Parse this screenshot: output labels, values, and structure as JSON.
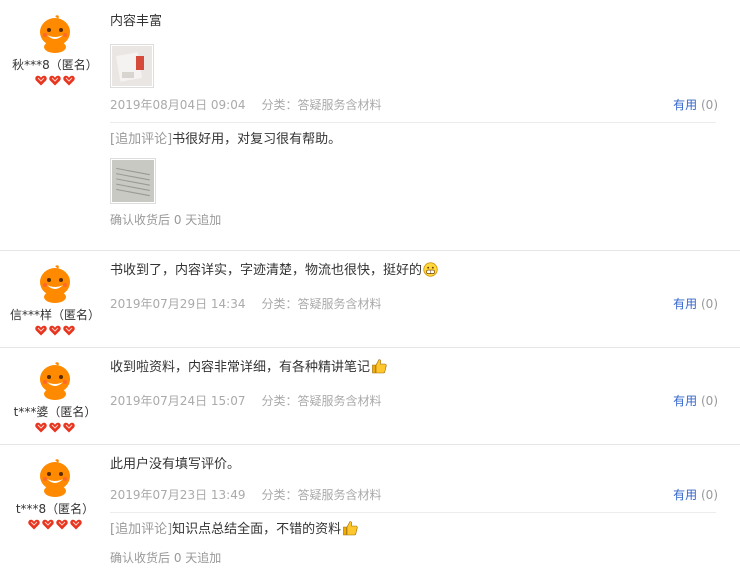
{
  "reviews": [
    {
      "user": {
        "name": "秋***8（匿名）",
        "rank_hearts": 3
      },
      "text": "内容丰富",
      "sticker": "",
      "images": [
        "photo-thumbnail"
      ],
      "date": "2019年08月04日 09:04",
      "category": "分类：答疑服务含材料",
      "useful_label": "有用",
      "useful_count": "(0)",
      "append": {
        "tag": "[追加评论]",
        "text": "书很好用，对复习很有帮助。",
        "sticker": "",
        "images": [
          "photo-thumbnail"
        ],
        "note": "确认收货后 0 天追加"
      }
    },
    {
      "user": {
        "name": "信***样（匿名）",
        "rank_hearts": 3
      },
      "text": "书收到了，内容详实，字迹清楚，物流也很快，挺好的",
      "sticker": "grin-emoji-icon",
      "images": [],
      "date": "2019年07月29日 14:34",
      "category": "分类：答疑服务含材料",
      "useful_label": "有用",
      "useful_count": "(0)"
    },
    {
      "user": {
        "name": "t***婆（匿名）",
        "rank_hearts": 3
      },
      "text": "收到啦资料，内容非常详细，有各种精讲笔记",
      "sticker": "thumbs-up-icon",
      "images": [],
      "date": "2019年07月24日 15:07",
      "category": "分类：答疑服务含材料",
      "useful_label": "有用",
      "useful_count": "(0)"
    },
    {
      "user": {
        "name": "t***8（匿名）",
        "rank_hearts": 4
      },
      "text": "此用户没有填写评价。",
      "sticker": "",
      "images": [],
      "date": "2019年07月23日 13:49",
      "category": "分类：答疑服务含材料",
      "useful_label": "有用",
      "useful_count": "(0)",
      "append": {
        "tag": "[追加评论]",
        "text": "知识点总结全面，不错的资料",
        "sticker": "thumbs-up-icon",
        "images": [],
        "note": "确认收货后 0 天追加"
      }
    }
  ],
  "colors": {
    "link": "#3366cc",
    "meta": "#aaaaaa",
    "heart": "#e8351f",
    "avatar_bg": "#ff8a00"
  }
}
